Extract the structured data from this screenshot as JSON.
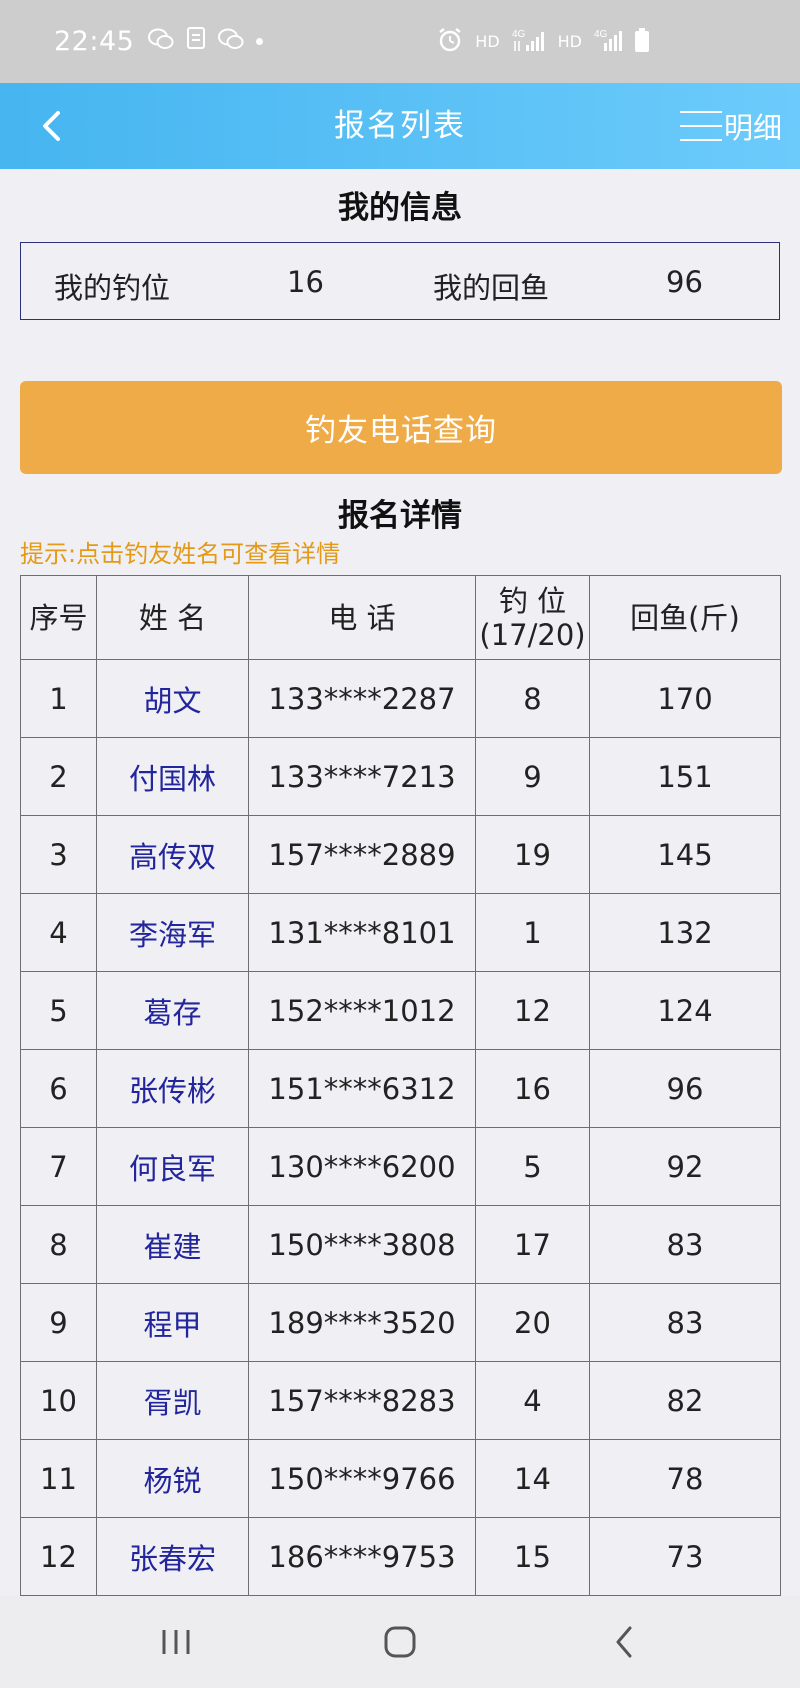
{
  "status_bar": {
    "time": "22:45",
    "left_icons": [
      "wechat-icon",
      "document-icon",
      "wechat-icon",
      "dot-icon"
    ],
    "right_icons": [
      "alarm-icon",
      "hd-icon",
      "4g-signal-icon",
      "hd-icon",
      "4g-signal-icon",
      "battery-icon"
    ],
    "hd_label": "HD",
    "net_label": "4G"
  },
  "nav": {
    "back_icon": "chevron-left-icon",
    "title": "报名列表",
    "detail_label": "明细"
  },
  "my_info": {
    "section_title": "我的信息",
    "seat_label": "我的钓位",
    "seat_value": "16",
    "catch_label": "我的回鱼",
    "catch_value": "96"
  },
  "phone_query_label": "钓友电话查询",
  "signup": {
    "section_title": "报名详情",
    "hint": "提示:点击钓友姓名可查看详情",
    "headers": {
      "index": "序号",
      "name": "姓 名",
      "phone": "电 话",
      "seat_line1": "钓 位",
      "seat_line2": "(17/20)",
      "catch": "回鱼(斤)"
    },
    "rows": [
      {
        "index": "1",
        "name": "胡文",
        "phone": "133****2287",
        "seat": "8",
        "catch": "170"
      },
      {
        "index": "2",
        "name": "付国林",
        "phone": "133****7213",
        "seat": "9",
        "catch": "151"
      },
      {
        "index": "3",
        "name": "高传双",
        "phone": "157****2889",
        "seat": "19",
        "catch": "145"
      },
      {
        "index": "4",
        "name": "李海军",
        "phone": "131****8101",
        "seat": "1",
        "catch": "132"
      },
      {
        "index": "5",
        "name": "葛存",
        "phone": "152****1012",
        "seat": "12",
        "catch": "124"
      },
      {
        "index": "6",
        "name": "张传彬",
        "phone": "151****6312",
        "seat": "16",
        "catch": "96"
      },
      {
        "index": "7",
        "name": "何良军",
        "phone": "130****6200",
        "seat": "5",
        "catch": "92"
      },
      {
        "index": "8",
        "name": "崔建",
        "phone": "150****3808",
        "seat": "17",
        "catch": "83"
      },
      {
        "index": "9",
        "name": "程甲",
        "phone": "189****3520",
        "seat": "20",
        "catch": "83"
      },
      {
        "index": "10",
        "name": "胥凯",
        "phone": "157****8283",
        "seat": "4",
        "catch": "82"
      },
      {
        "index": "11",
        "name": "杨锐",
        "phone": "150****9766",
        "seat": "14",
        "catch": "78"
      },
      {
        "index": "12",
        "name": "张春宏",
        "phone": "186****9753",
        "seat": "15",
        "catch": "73"
      }
    ]
  },
  "system_nav": {
    "icons": [
      "recent-apps-icon",
      "home-icon",
      "system-back-icon"
    ]
  }
}
